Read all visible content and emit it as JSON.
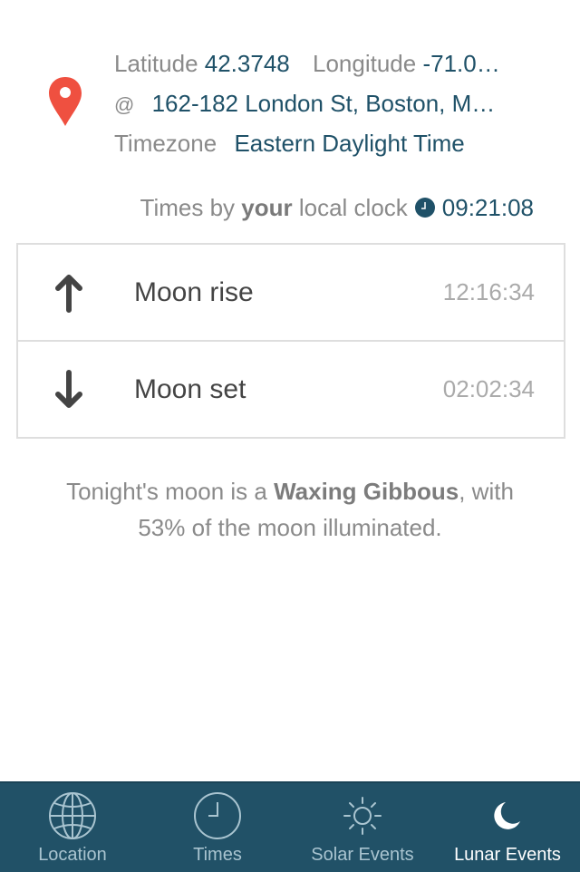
{
  "location": {
    "latitude_label": "Latitude",
    "latitude_value": "42.3748",
    "longitude_label": "Longitude",
    "longitude_value": "-71.0…",
    "at_symbol": "@",
    "address": "162-182 London St, Boston, M…",
    "timezone_label": "Timezone",
    "timezone_value": "Eastern Daylight Time",
    "pin_icon": "map-pin-icon",
    "pin_color": "#ef5040"
  },
  "clock": {
    "prefix": "Times by",
    "emphasis": "your",
    "suffix": "local clock",
    "icon": "clock-icon",
    "time": "09:21:08"
  },
  "events": [
    {
      "icon": "arrow-up-icon",
      "label": "Moon rise",
      "time": "12:16:34"
    },
    {
      "icon": "arrow-down-icon",
      "label": "Moon set",
      "time": "02:02:34"
    }
  ],
  "phase": {
    "prefix": "Tonight's moon is a",
    "phase_name": "Waxing Gibbous",
    "suffix": ", with",
    "illumination_line": "53% of the moon illuminated."
  },
  "tabbar": {
    "background": "#215167",
    "tabs": [
      {
        "label": "Location",
        "icon": "globe-icon",
        "active": false
      },
      {
        "label": "Times",
        "icon": "clock-icon",
        "active": false
      },
      {
        "label": "Solar Events",
        "icon": "sun-icon",
        "active": false
      },
      {
        "label": "Lunar Events",
        "icon": "moon-icon",
        "active": true
      }
    ]
  }
}
